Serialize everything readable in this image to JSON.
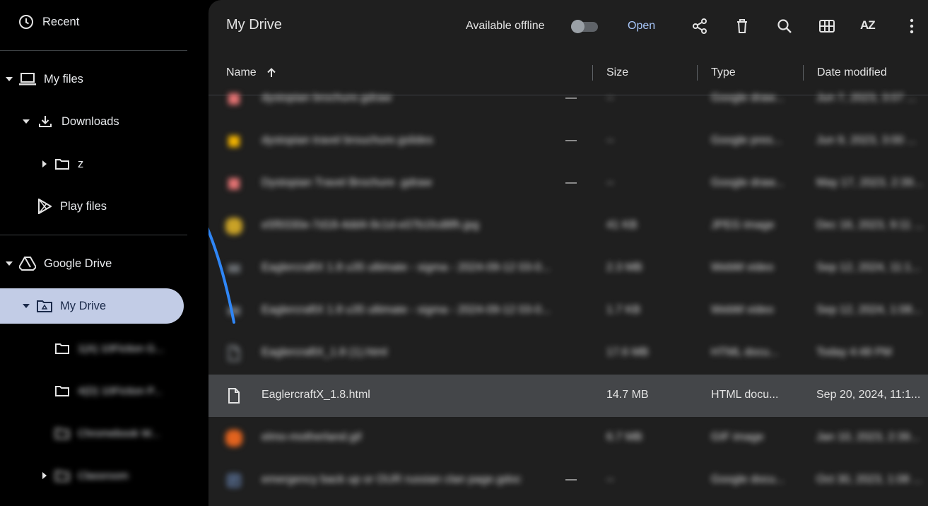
{
  "sidebar": {
    "recent": "Recent",
    "my_files": "My files",
    "downloads": "Downloads",
    "z_folder": "z",
    "play_files": "Play files",
    "google_drive": "Google Drive",
    "my_drive": "My Drive",
    "sub_items": [
      {
        "label": "1(A) 10Fiction G..."
      },
      {
        "label": "4(D) 10Fiction P..."
      },
      {
        "label": "Chromebook W..."
      },
      {
        "label": "Classroom"
      }
    ]
  },
  "toolbar": {
    "title": "My Drive",
    "available_offline": "Available offline",
    "open": "Open",
    "sort_icon_text": "AZ"
  },
  "columns": {
    "name": "Name",
    "size": "Size",
    "type": "Type",
    "date": "Date modified"
  },
  "files": [
    {
      "name": "dystopian brochure.gdraw",
      "size": "--",
      "type": "Google draw...",
      "date": "Jun 7, 2023, 3:07 ...",
      "dash": "—",
      "icon": "drawing-icon",
      "color": "#e57373"
    },
    {
      "name": "dystopian travel brouchure.gslides",
      "size": "--",
      "type": "Google pres...",
      "date": "Jun 9, 2023, 3:00 ...",
      "dash": "—",
      "icon": "slides-icon",
      "color": "#f4b400"
    },
    {
      "name": "Dystopian Travel Brochure .gdraw",
      "size": "--",
      "type": "Google draw...",
      "date": "May 17, 2023, 2:39...",
      "dash": "—",
      "icon": "drawing-icon",
      "color": "#e57373"
    },
    {
      "name": "e5f9330e-7d18-4dd4-9c1d-e07b1fcd8fh.jpg",
      "size": "41 KB",
      "type": "JPEG image",
      "date": "Dec 16, 2023, 9:11 ...",
      "dash": "",
      "icon": "image-thumb",
      "color": "#c9a227"
    },
    {
      "name": "EaglercraftX 1.8 u35 ultimate - sigma - 2024-09-12 03-0...",
      "size": "2.3 MB",
      "type": "WebM video",
      "date": "Sep 12, 2024, 11:1...",
      "dash": "",
      "icon": "video-icon",
      "color": "#9aa0a6"
    },
    {
      "name": "EaglercraftX 1.8 u35 ultimate - sigma - 2024-09-12 03-0...",
      "size": "1.7 KB",
      "type": "WebM video",
      "date": "Sep 12, 2024, 1:08...",
      "dash": "",
      "icon": "video-icon",
      "color": "#9aa0a6"
    },
    {
      "name": "EaglercraftX_1.8 (1).html",
      "size": "17.6 MB",
      "type": "HTML docu...",
      "date": "Today 4:48 PM",
      "dash": "",
      "icon": "file-icon",
      "color": "#9aa0a6"
    },
    {
      "name": "EaglercraftX_1.8.html",
      "size": "14.7 MB",
      "type": "HTML docu...",
      "date": "Sep 20, 2024, 11:1...",
      "dash": "",
      "icon": "file-icon",
      "color": "#e3e3e3",
      "selected": true
    },
    {
      "name": "elmo-motherland.gif",
      "size": "6.7 MB",
      "type": "GIF image",
      "date": "Jan 10, 2023, 2:39...",
      "dash": "",
      "icon": "gif-thumb",
      "color": "#e2631f"
    },
    {
      "name": "emergency back up or OUR russian clan page.gdoc",
      "size": "--",
      "type": "Google docu...",
      "date": "Oct 30, 2023, 1:08 ...",
      "dash": "—",
      "icon": "docs-icon",
      "color": "#8ab4f8"
    }
  ]
}
